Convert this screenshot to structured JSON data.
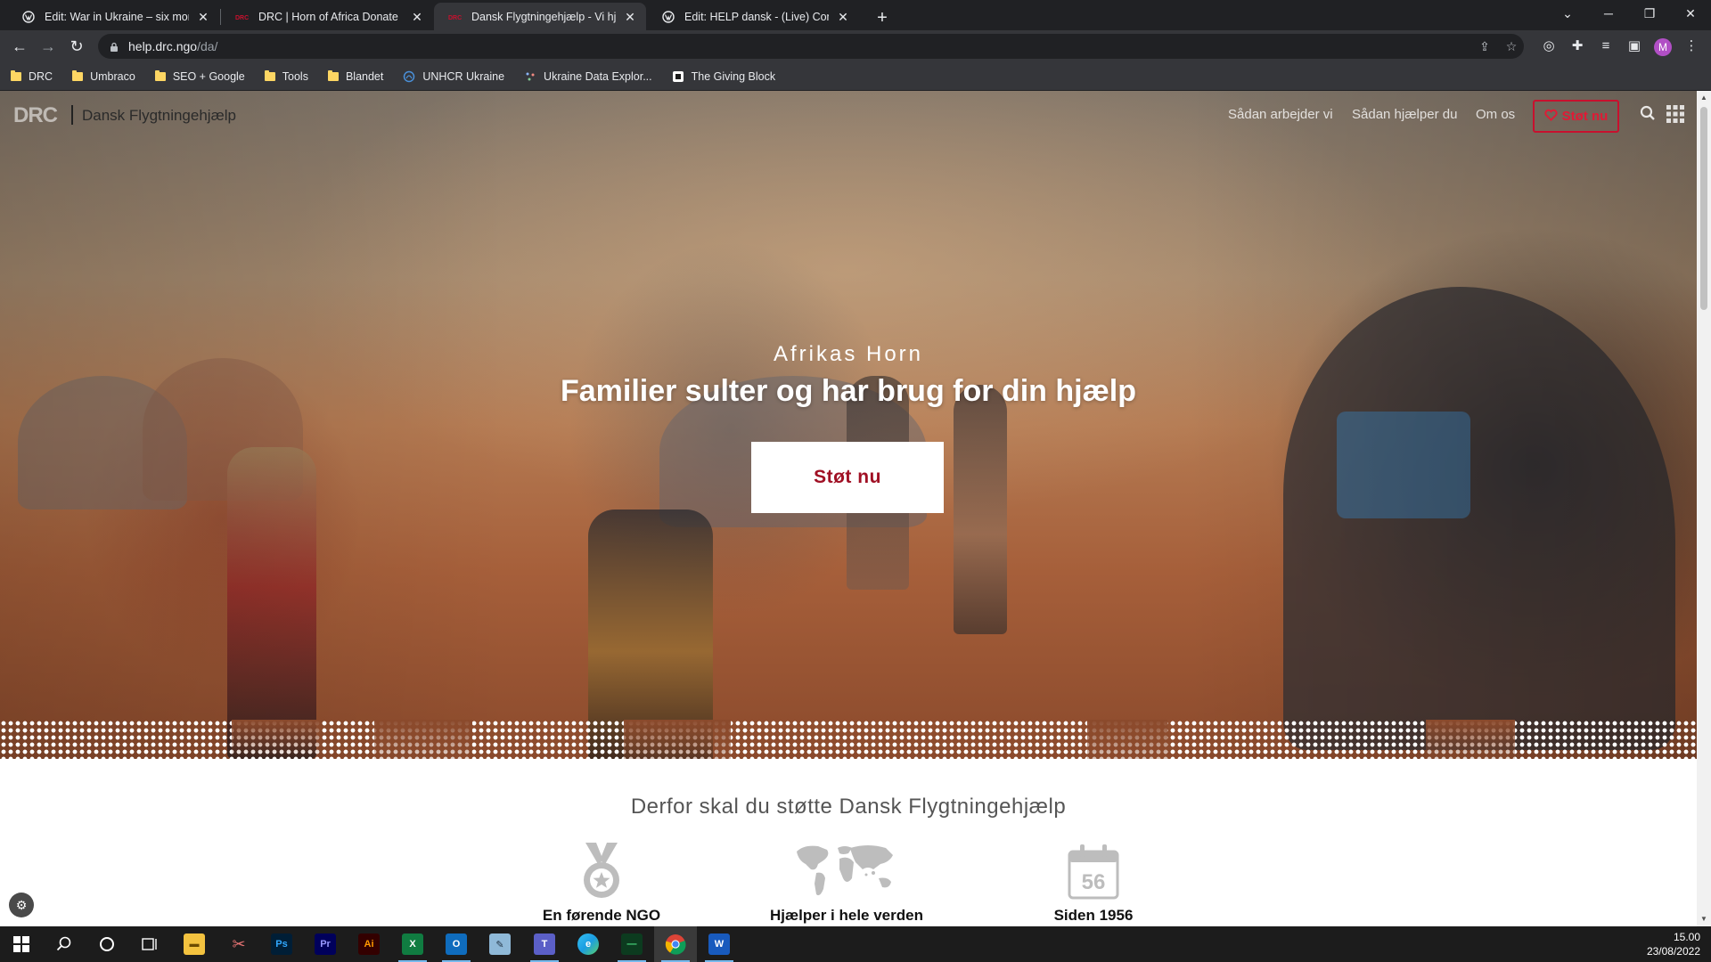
{
  "browser": {
    "tabs": [
      {
        "title": "Edit: War in Ukraine – six months",
        "favicon": "wordpress-icon",
        "active": false
      },
      {
        "title": "DRC | Horn of Africa Donate",
        "favicon": "drc-icon",
        "active": false
      },
      {
        "title": "Dansk Flygtningehjælp - Vi hjælp",
        "favicon": "drc-icon",
        "active": true
      },
      {
        "title": "Edit: HELP dansk - (Live) Content",
        "favicon": "wordpress-icon",
        "active": false
      }
    ],
    "url_host": "help.drc.ngo",
    "url_path": "/da/",
    "avatar_letter": "M",
    "bookmarks": [
      {
        "label": "DRC",
        "type": "folder"
      },
      {
        "label": "Umbraco",
        "type": "folder"
      },
      {
        "label": "SEO + Google",
        "type": "folder"
      },
      {
        "label": "Tools",
        "type": "folder"
      },
      {
        "label": "Blandet",
        "type": "folder"
      },
      {
        "label": "UNHCR Ukraine",
        "type": "site"
      },
      {
        "label": "Ukraine Data Explor...",
        "type": "site"
      },
      {
        "label": "The Giving Block",
        "type": "site"
      }
    ]
  },
  "site": {
    "logo_text": "DRC",
    "name": "Dansk Flygtningehjælp",
    "nav": [
      "Sådan arbejder vi",
      "Sådan hjælper du",
      "Om os"
    ],
    "donate_label": "Støt nu",
    "accent_color": "#c8102e"
  },
  "hero": {
    "eyebrow": "Afrikas Horn",
    "headline": "Familier sulter og har brug for din hjælp",
    "cta_label": "Støt nu"
  },
  "why": {
    "title": "Derfor skal du støtte Dansk Flygtningehjælp",
    "features": [
      {
        "label": "En førende NGO",
        "icon": "medal-icon"
      },
      {
        "label": "Hjælper i hele verden",
        "icon": "world-map-icon"
      },
      {
        "label": "Siden 1956",
        "icon": "calendar-icon",
        "icon_text": "56"
      }
    ]
  },
  "taskbar": {
    "time": "15.00",
    "date": "23/08/2022"
  }
}
